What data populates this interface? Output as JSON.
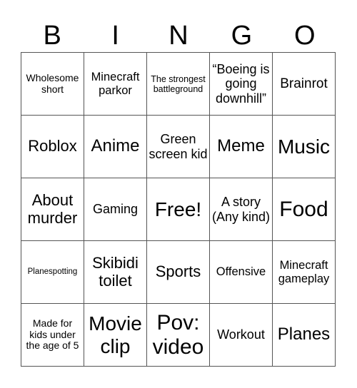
{
  "title_letters": [
    "B",
    "I",
    "N",
    "G",
    "O"
  ],
  "cells": [
    [
      "Wholesome short",
      "Minecraft parkor",
      "The strongest battleground",
      "“Boeing is going downhill”",
      "Brainrot"
    ],
    [
      "Roblox",
      "Anime",
      "Green screen kid",
      "Meme",
      "Music"
    ],
    [
      "About murder",
      "Gaming",
      "Free!",
      "A story (Any kind)",
      "Food"
    ],
    [
      "Planespotting",
      "Skibidi toilet",
      "Sports",
      "Offensive",
      "Minecraft gameplay"
    ],
    [
      "Made for kids under the age of 5",
      "Movie clip",
      "Pov: video",
      "Workout",
      "Planes"
    ]
  ],
  "free_space": "Free!"
}
